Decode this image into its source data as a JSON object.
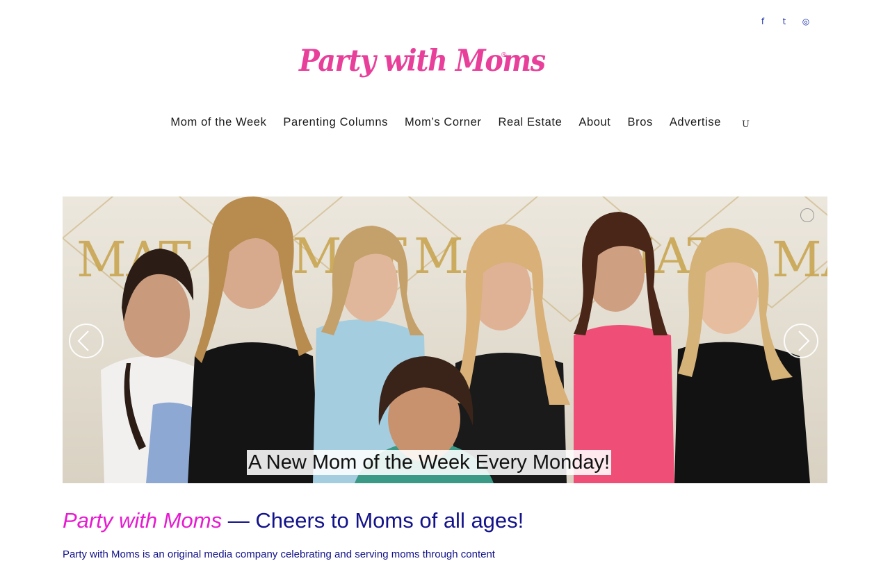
{
  "header": {
    "social_icons": [
      {
        "name": "facebook-icon",
        "glyph": "f"
      },
      {
        "name": "twitter-icon",
        "glyph": "t"
      },
      {
        "name": "instagram-icon",
        "glyph": "◎"
      }
    ],
    "logo_text": "Party with Moms",
    "logo_mark": "®",
    "logo_color": "#e8409a"
  },
  "nav": {
    "items": [
      "Mom of the Week",
      "Parenting Columns",
      "Mom’s Corner",
      "Real Estate",
      "About",
      "Bros",
      "Advertise"
    ],
    "search_icon_glyph": "U"
  },
  "slider": {
    "caption": "A New Mom of the Week Every Monday!",
    "backdrop_text": "MAT"
  },
  "main": {
    "tagline_brand": "Party with Moms",
    "tagline_rest": " — Cheers to Moms of all ages!",
    "intro": "Party with Moms is an original media company celebrating and serving moms through content"
  },
  "colors": {
    "brand_pink": "#e8409a",
    "tagline_magenta": "#e61ad0",
    "tagline_navy": "#12128a",
    "social_blue": "#1a2fa8"
  }
}
